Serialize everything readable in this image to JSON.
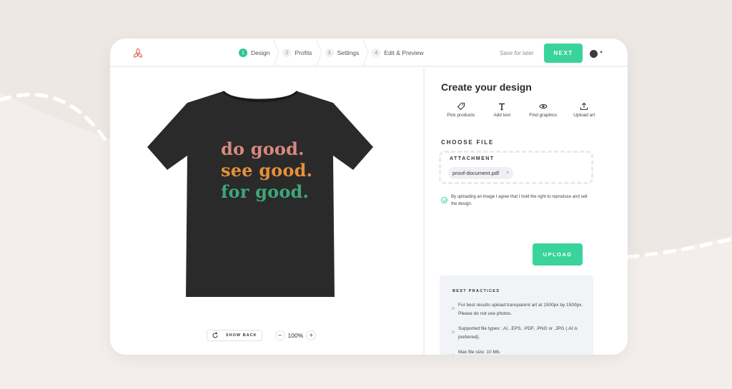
{
  "steps": [
    {
      "num": "1",
      "label": "Design",
      "active": true
    },
    {
      "num": "2",
      "label": "Profits",
      "active": false
    },
    {
      "num": "3",
      "label": "Settings",
      "active": false
    },
    {
      "num": "4",
      "label": "Edit & Preview",
      "active": false
    }
  ],
  "header": {
    "save_label": "Save for later",
    "next_label": "NEXT"
  },
  "design": {
    "slogan": [
      "do good.",
      "see good.",
      "for good."
    ],
    "show_back_label": "SHOW BACK",
    "zoom_minus": "−",
    "zoom_value": "100%",
    "zoom_plus": "+"
  },
  "panel": {
    "title": "Create your design",
    "tools": [
      {
        "label": "Pick products",
        "icon": "tag-icon"
      },
      {
        "label": "Add text",
        "icon": "text-icon"
      },
      {
        "label": "Find graphics",
        "icon": "eye-icon"
      },
      {
        "label": "Upload art",
        "icon": "upload-icon"
      }
    ],
    "choose_file_label": "CHOOSE FILE",
    "attachment_label": "ATTACHMENT",
    "file_name": "proof-document.pdf",
    "remove_glyph": "×",
    "agree_text": "By uploading an image I agree that I hold the right to reproduce and sell the design.",
    "agree_checked": true,
    "upload_label": "UPLOAD",
    "best_practices": {
      "title": "BEST PRACTICES",
      "items": [
        "For best results upload transparent art at 1500px by 1500px. Please do not use photos.",
        "Supported file types: .AI, .EPS, .PDF, .PNG or .JPG (.AI is preferred).",
        "Max file size: 10 Mb."
      ]
    }
  },
  "colors": {
    "accent": "#3ad39b",
    "shirt": "#2a2a2a",
    "slogan_line1": "#d8897f",
    "slogan_line2": "#e5913a",
    "slogan_line3": "#3da77c"
  }
}
